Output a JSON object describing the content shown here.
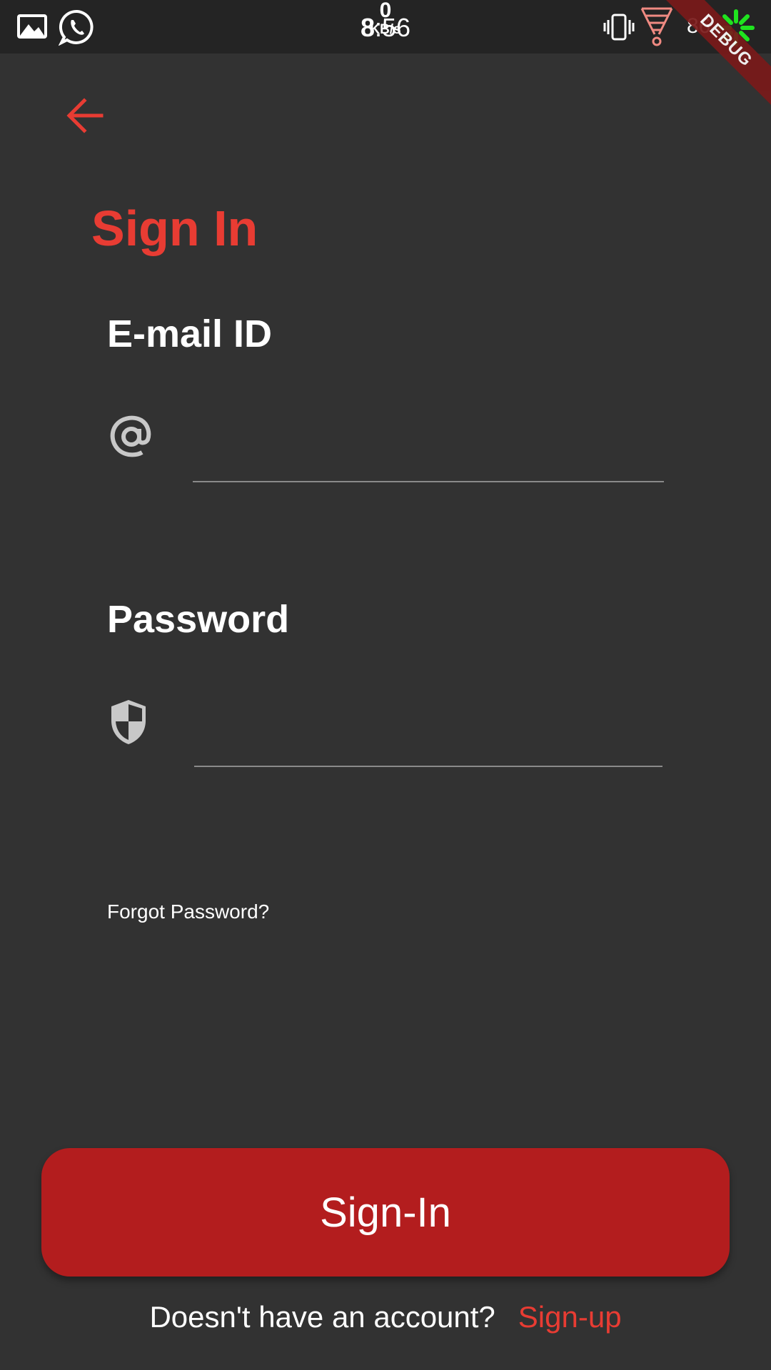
{
  "status_bar": {
    "network_speed_value": "0",
    "network_speed_unit": "KB/s",
    "time_hour": "8",
    "time_rest": ":56",
    "battery": "86",
    "icons": [
      "gallery-icon",
      "whatsapp-icon",
      "vibrate-icon",
      "wifi-icon",
      "spinner-icon"
    ]
  },
  "debug_banner": "DEBUG",
  "page": {
    "title": "Sign In",
    "email_label": "E-mail ID",
    "email_value": "",
    "password_label": "Password",
    "password_value": "",
    "forgot_password": "Forgot Password?",
    "signin_button": "Sign-In",
    "signup_prompt": "Doesn't have an account?",
    "signup_link": "Sign-up"
  },
  "colors": {
    "background": "#323232",
    "accent": "#e83c33",
    "button": "#b31d1e"
  }
}
